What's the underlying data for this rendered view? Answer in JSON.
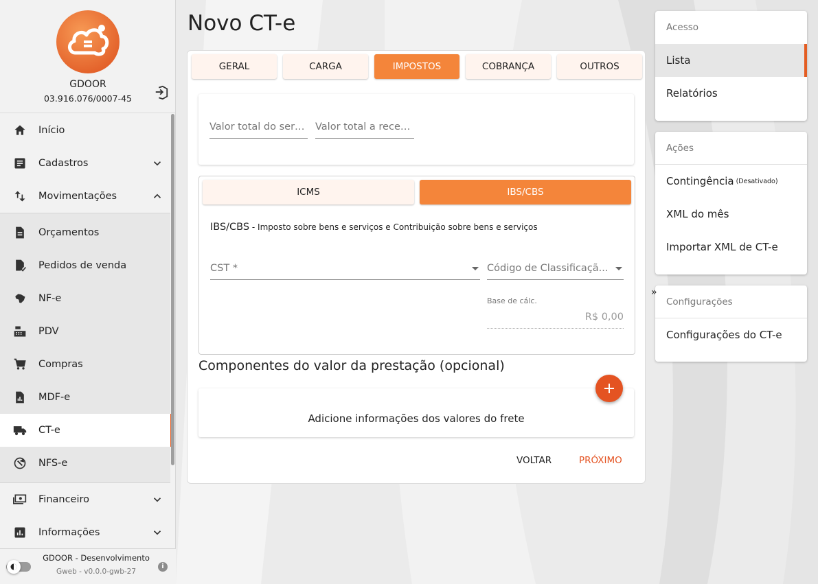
{
  "sidebar": {
    "company_name": "GDOOR",
    "company_doc": "03.916.076/0007-45",
    "items": [
      {
        "label": "Início"
      },
      {
        "label": "Cadastros"
      },
      {
        "label": "Movimentações"
      }
    ],
    "sub_items": [
      {
        "label": "Orçamentos"
      },
      {
        "label": "Pedidos de venda"
      },
      {
        "label": "NF-e"
      },
      {
        "label": "PDV"
      },
      {
        "label": "Compras"
      },
      {
        "label": "MDF-e"
      },
      {
        "label": "CT-e"
      },
      {
        "label": "NFS-e"
      }
    ],
    "bottom_items": [
      {
        "label": "Financeiro"
      },
      {
        "label": "Informações"
      }
    ],
    "footer": {
      "title": "GDOOR - Desenvolvimento",
      "version": "Gweb - v0.0.0-gwb-27",
      "info": "i"
    }
  },
  "main": {
    "title": "Novo CT-e",
    "tabs": [
      "GERAL",
      "CARGA",
      "IMPOSTOS",
      "COBRANÇA",
      "OUTROS"
    ],
    "active_tab": "IMPOSTOS",
    "fields": {
      "valor_servico": "Valor total do serv...",
      "valor_receber": "Valor total a receb..."
    },
    "tax_tabs": [
      "ICMS",
      "IBS/CBS"
    ],
    "active_tax_tab": "IBS/CBS",
    "tax_desc_title": "IBS/CBS",
    "tax_desc_text": " - Imposto sobre bens e serviços e Contribuição sobre bens e serviços",
    "cst_label": "CST *",
    "classificacao_label": "Código de Classificaçã...",
    "base_label": "Base de cálc.",
    "base_value": "R$ 0,00",
    "components_title": "Componentes do valor da prestação (opcional)",
    "components_empty": "Adicione informações dos valores do frete",
    "btn_back": "VOLTAR",
    "btn_next": "PRÓXIMO"
  },
  "right": {
    "acesso": {
      "header": "Acesso",
      "items": [
        "Lista",
        "Relatórios"
      ]
    },
    "acoes": {
      "header": "Ações",
      "contingencia": "Contingência",
      "contingencia_note": "(Desativado)",
      "items": [
        "XML do mês",
        "Importar XML de CT-e"
      ]
    },
    "config": {
      "header": "Configurações",
      "items": [
        "Configurações do CT-e"
      ]
    },
    "collapse": "»"
  },
  "colors": {
    "accent": "#f4853a",
    "brand": "#e45d22"
  }
}
